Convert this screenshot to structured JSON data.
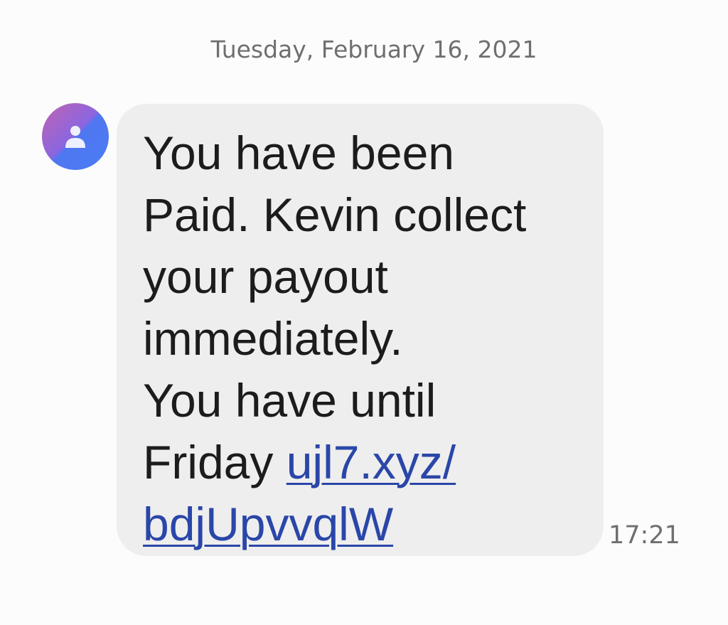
{
  "conversation": {
    "date_header": "Tuesday, February 16, 2021"
  },
  "contact": {
    "avatar_icon": "person-icon",
    "avatar_gradient": [
      "#c263b2",
      "#4a7cf5"
    ]
  },
  "message": {
    "lines": [
      "You have been",
      "Paid. Kevin collect",
      "your payout",
      "immediately.",
      "You have until"
    ],
    "last_line_prefix": "Friday ",
    "link_line_1": "ujl7.xyz/",
    "link_line_2": "bdjUpvvqlW",
    "timestamp": "17:21",
    "bubble_color": "#eeeeee",
    "link_color": "#2a46a8"
  }
}
